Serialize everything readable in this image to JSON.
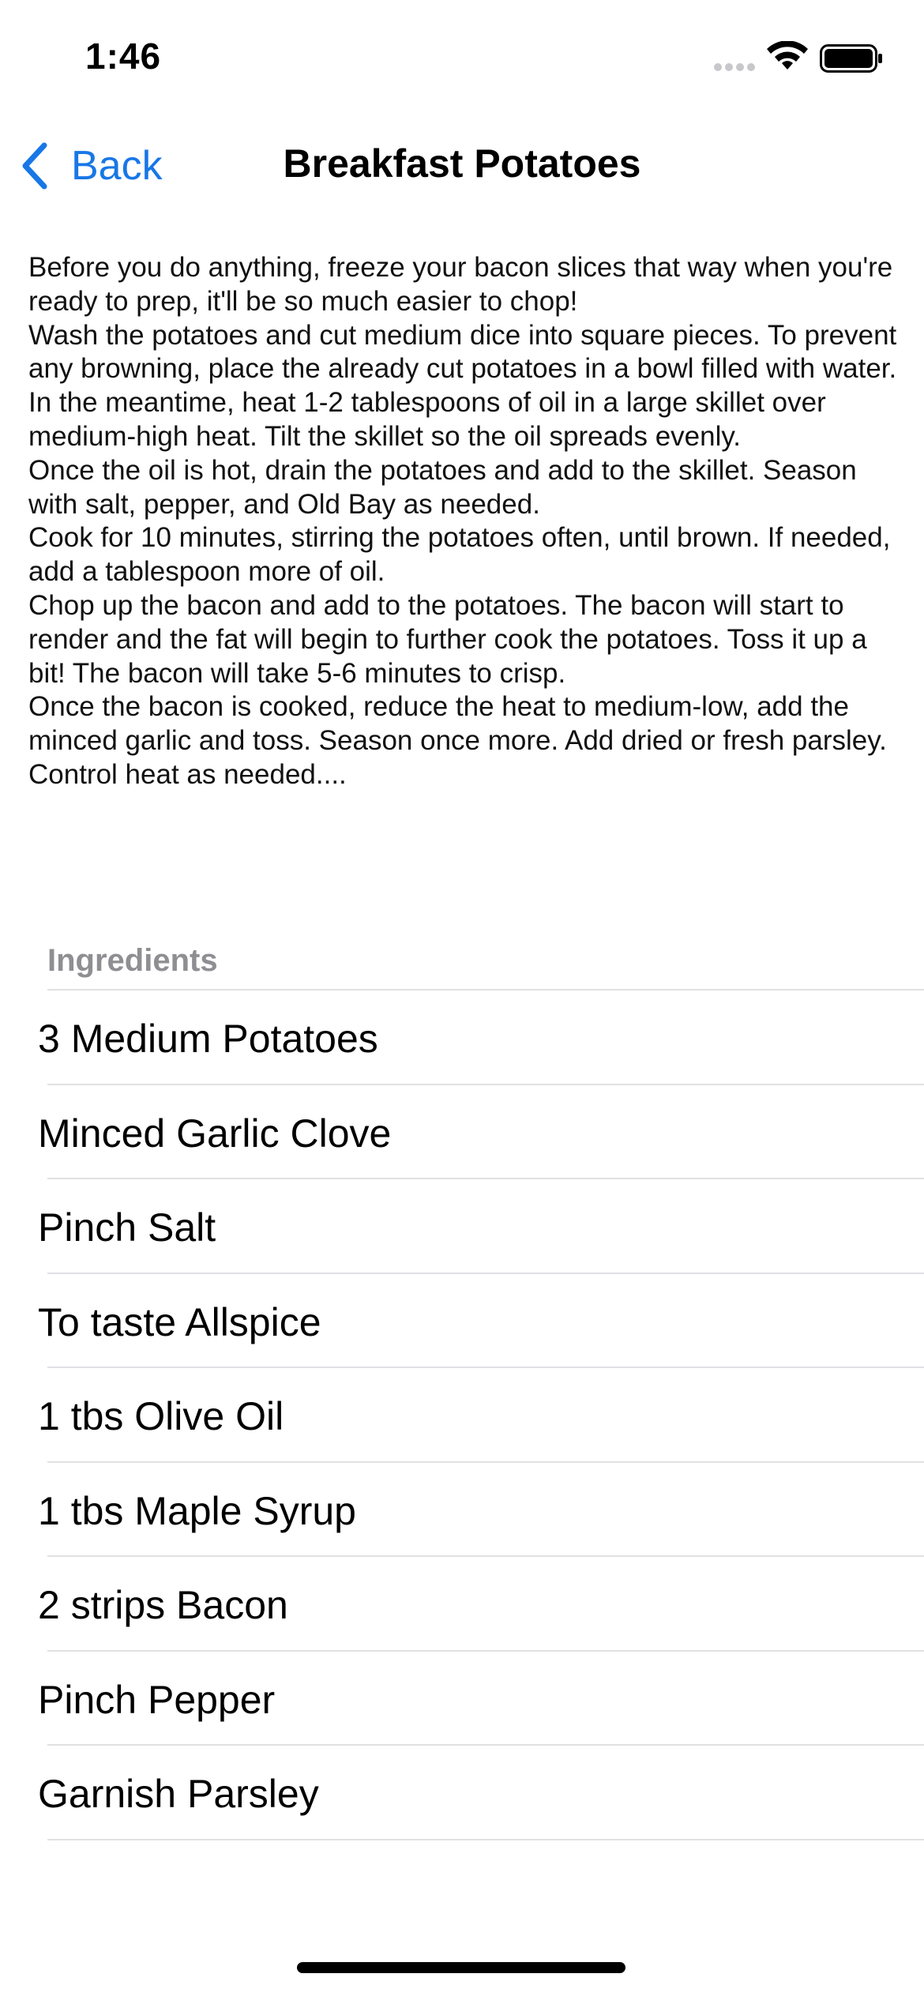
{
  "status_bar": {
    "time": "1:46"
  },
  "nav": {
    "back_label": "Back",
    "title": "Breakfast Potatoes"
  },
  "instructions": "Before you do anything, freeze your bacon slices that way when you're ready to prep, it'll be so much easier to chop!\nWash the potatoes and cut medium dice into square pieces. To prevent any browning, place the already cut potatoes in a bowl filled with water.\nIn the meantime, heat 1-2 tablespoons of oil in a large skillet over medium-high heat. Tilt the skillet so the oil spreads evenly.\nOnce the oil is hot, drain the potatoes and add to the skillet. Season with salt, pepper, and Old Bay as needed.\nCook for 10 minutes, stirring the potatoes often, until brown. If needed, add a tablespoon more of oil.\nChop up the bacon and add to the potatoes. The bacon will start to render and the fat will begin to further cook the potatoes. Toss it up a bit! The bacon will take 5-6 minutes to crisp.\nOnce the bacon is cooked, reduce the heat to medium-low, add the minced garlic and toss. Season once more. Add dried or fresh parsley. Control heat as needed....",
  "ingredients": {
    "header": "Ingredients",
    "items": [
      "3 Medium Potatoes",
      "Minced Garlic Clove",
      "Pinch Salt",
      "To taste Allspice",
      "1 tbs Olive Oil",
      "1 tbs Maple Syrup",
      "2 strips Bacon",
      "Pinch Pepper",
      "Garnish Parsley"
    ]
  },
  "colors": {
    "accent": "#1877e6",
    "secondary_text": "#8e8e93",
    "separator": "#e1e1e4"
  }
}
